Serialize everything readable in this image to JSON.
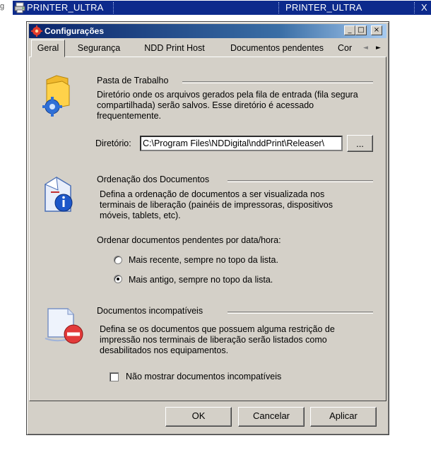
{
  "taskbar": {
    "left_fragment": "g",
    "title_left": "PRINTER_ULTRA",
    "title_right": "PRINTER_ULTRA",
    "close_glyph": "X"
  },
  "window": {
    "title": "Configurações",
    "icon": "app-settings-icon",
    "minimize_glyph": "_",
    "maximize_glyph": "□",
    "close_glyph": "×"
  },
  "tabs": [
    {
      "label": "Geral",
      "active": true
    },
    {
      "label": "Segurança"
    },
    {
      "label": "NDD Print Host"
    },
    {
      "label": "Documentos pendentes"
    },
    {
      "label": "Cor"
    }
  ],
  "tab_scroll": {
    "left": "◄",
    "right": "►"
  },
  "workdir": {
    "heading": "Pasta de Trabalho",
    "description": "Diretório onde os arquivos gerados pela fila de entrada (fila segura compartilhada) serão salvos. Esse diretório é acessado frequentemente.",
    "field_label": "Diretório:",
    "field_value": "C:\\Program Files\\NDDigital\\nddPrint\\Releaser\\",
    "browse_label": "...",
    "icon": "folder-gear-icon"
  },
  "ordering": {
    "heading": "Ordenação dos Documentos",
    "description": "Defina a ordenação de documentos a ser visualizada nos terminais de liberação (painéis de impressoras, dispositivos móveis, tablets, etc).",
    "question": "Ordenar documentos pendentes por data/hora:",
    "options": [
      {
        "label": "Mais recente, sempre no topo da lista.",
        "selected": false
      },
      {
        "label": "Mais antigo, sempre no topo da lista.",
        "selected": true
      }
    ],
    "icon": "document-info-icon"
  },
  "incompatible": {
    "heading": "Documentos incompatíveis",
    "description": "Defina se os documentos que possuem alguma restrição de impressão nos terminais de liberação serão listados como desabilitados nos equipamentos.",
    "checkbox_label": "Não mostrar documentos incompatíveis",
    "checked": false,
    "icon": "document-blocked-icon"
  },
  "footer": {
    "ok": "OK",
    "cancel": "Cancelar",
    "apply": "Aplicar"
  },
  "colors": {
    "taskbar": "#0d2a8c",
    "title_gradient_start": "#0a246a",
    "title_gradient_end": "#a6caf0",
    "dialog_face": "#d4d0c8"
  }
}
